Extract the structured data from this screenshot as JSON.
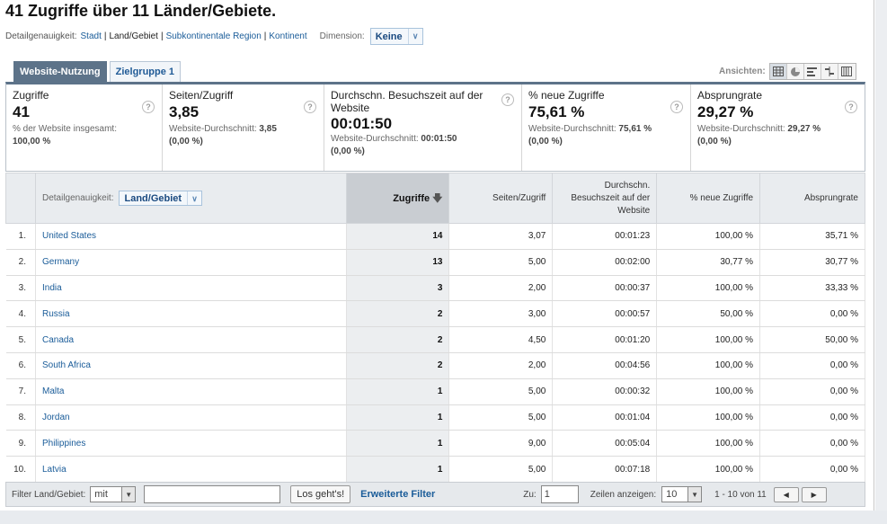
{
  "title": "41 Zugriffe über 11 Länder/Gebiete.",
  "detail": {
    "label": "Detailgenauigkeit:",
    "options": [
      "Stadt",
      "Land/Gebiet",
      "Subkontinentale Region",
      "Kontinent"
    ],
    "current_index": 1,
    "dimension_label": "Dimension:",
    "dimension_value": "Keine"
  },
  "tabs": [
    "Website-Nutzung",
    "Zielgruppe 1"
  ],
  "views_label": "Ansichten:",
  "summary": [
    {
      "label": "Zugriffe",
      "value": "41",
      "sub_text": "% der Website insgesamt:",
      "sub_value": "100,00 %",
      "sub_extra": ""
    },
    {
      "label": "Seiten/Zugriff",
      "value": "3,85",
      "sub_text": "Website-Durchschnitt:",
      "sub_value": "3,85",
      "sub_extra": "(0,00 %)"
    },
    {
      "label": "Durchschn. Besuchszeit auf der Website",
      "value": "00:01:50",
      "sub_text": "Website-Durchschnitt:",
      "sub_value": "00:01:50",
      "sub_extra": "(0,00 %)"
    },
    {
      "label": "% neue Zugriffe",
      "value": "75,61 %",
      "sub_text": "Website-Durchschnitt:",
      "sub_value": "75,61 %",
      "sub_extra": "(0,00 %)"
    },
    {
      "label": "Absprungrate",
      "value": "29,27 %",
      "sub_text": "Website-Durchschnitt:",
      "sub_value": "29,27 %",
      "sub_extra": "(0,00 %)"
    }
  ],
  "table": {
    "dim_label": "Detailgenauigkeit:",
    "dim_value": "Land/Gebiet",
    "headers": [
      "Zugriffe",
      "Seiten/Zugriff",
      "Durchschn. Besuchszeit auf der Website",
      "% neue Zugriffe",
      "Absprungrate"
    ],
    "rows": [
      [
        "1.",
        "United States",
        "14",
        "3,07",
        "00:01:23",
        "100,00 %",
        "35,71 %"
      ],
      [
        "2.",
        "Germany",
        "13",
        "5,00",
        "00:02:00",
        "30,77 %",
        "30,77 %"
      ],
      [
        "3.",
        "India",
        "3",
        "2,00",
        "00:00:37",
        "100,00 %",
        "33,33 %"
      ],
      [
        "4.",
        "Russia",
        "2",
        "3,00",
        "00:00:57",
        "50,00 %",
        "0,00 %"
      ],
      [
        "5.",
        "Canada",
        "2",
        "4,50",
        "00:01:20",
        "100,00 %",
        "50,00 %"
      ],
      [
        "6.",
        "South Africa",
        "2",
        "2,00",
        "00:04:56",
        "100,00 %",
        "0,00 %"
      ],
      [
        "7.",
        "Malta",
        "1",
        "5,00",
        "00:00:32",
        "100,00 %",
        "0,00 %"
      ],
      [
        "8.",
        "Jordan",
        "1",
        "5,00",
        "00:01:04",
        "100,00 %",
        "0,00 %"
      ],
      [
        "9.",
        "Philippines",
        "1",
        "9,00",
        "00:05:04",
        "100,00 %",
        "0,00 %"
      ],
      [
        "10.",
        "Latvia",
        "1",
        "5,00",
        "00:07:18",
        "100,00 %",
        "0,00 %"
      ]
    ]
  },
  "footer": {
    "filter_label": "Filter Land/Gebiet:",
    "filter_mode": "mit",
    "filter_text": "",
    "go_button": "Los geht's!",
    "advanced_filter": "Erweiterte Filter",
    "goto_label": "Zu:",
    "goto_value": "1",
    "rows_label": "Zeilen anzeigen:",
    "rows_value": "10",
    "range_text": "1 - 10 von 11"
  }
}
